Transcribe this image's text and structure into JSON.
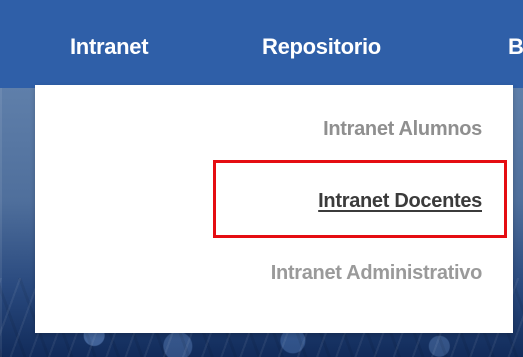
{
  "navigation": {
    "items": [
      {
        "label": "Intranet"
      },
      {
        "label": "Repositorio"
      },
      {
        "label": "B"
      }
    ]
  },
  "dropdown": {
    "items": [
      {
        "label": "Intranet Alumnos"
      },
      {
        "label": "Intranet Docentes"
      },
      {
        "label": "Intranet Administrativo"
      }
    ]
  },
  "colors": {
    "navbar": "#2f5fa8",
    "highlight": "#e50d12",
    "dropdown_background": "#ffffff"
  }
}
